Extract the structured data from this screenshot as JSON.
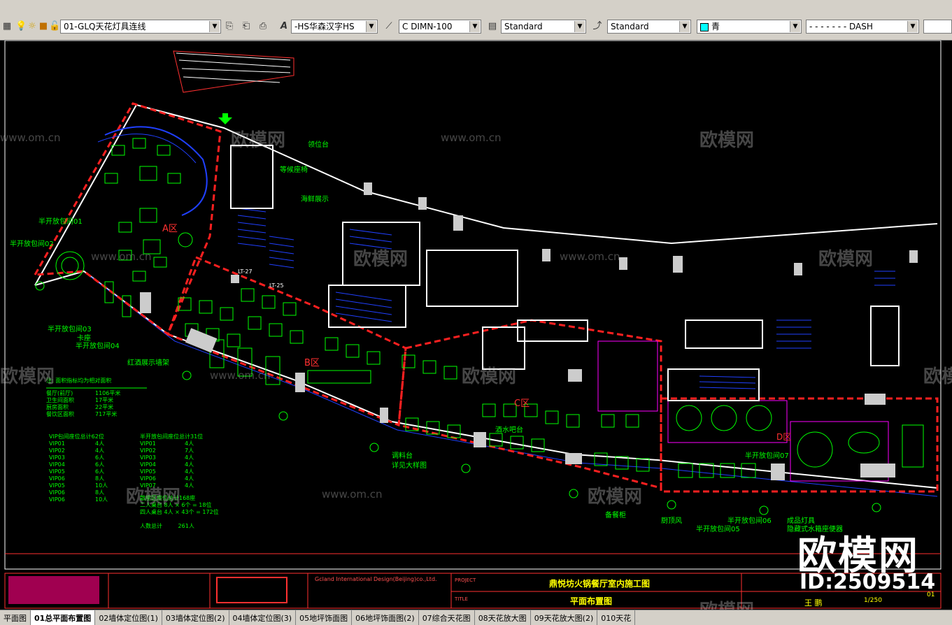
{
  "toolbar": {
    "layer_value": "01-GLQ天花灯具连线",
    "textstyle_value": "-HS华森汉字HS",
    "dimstyle_value": "C  DIMN-100",
    "tablestyle_value": "Standard",
    "mleaderstyle_value": "Standard",
    "color_value": "青",
    "linetype_value": "- - - - - - -  DASH"
  },
  "plan_labels": {
    "reception": "领位台",
    "waiting": "等候座椅",
    "seafood": "海鲜展示",
    "zone_a": "A区",
    "zone_b": "B区",
    "zone_c": "C区",
    "zone_d": "D区",
    "semi_private_01": "半开放包间01",
    "semi_private_02": "半开放包间02",
    "semi_private_03": "半开放包间03",
    "semi_private_04": "半开放包间04",
    "seating": "卡座",
    "wine_display": "红酒展示墙架",
    "sauce_station": "调料台",
    "sauce_detail": "详见大样图",
    "beverage": "酒水吧台",
    "prep_cabinet": "备餐柜",
    "kitchen_ventilation": "厨顶风",
    "semi_private_05": "半开放包间05",
    "semi_private_06": "半开放包间06",
    "semi_private_07": "半开放包间07",
    "lamp": "成品灯具",
    "concealed": "隐藏式水箱座便器",
    "lt27": "LT-27",
    "lt25": "LT-25"
  },
  "stats": {
    "title": "注: 面积指标均为相对面积",
    "rows": [
      {
        "k": "餐厅(前厅)",
        "v": "1106平米"
      },
      {
        "k": "卫生间面积",
        "v": "17平米"
      },
      {
        "k": "厨房面积",
        "v": "22平米"
      },
      {
        "k": "餐饮区面积",
        "v": "717平米"
      }
    ],
    "vip_header": "VIP包间座位总计62位",
    "semi_header": "半开放包间座位总计31位",
    "vip": [
      {
        "k": "VIP01",
        "v": "4人"
      },
      {
        "k": "VIP02",
        "v": "4人"
      },
      {
        "k": "VIP03",
        "v": "6人"
      },
      {
        "k": "VIP04",
        "v": "6人"
      },
      {
        "k": "VIP05",
        "v": "6人"
      },
      {
        "k": "VIP06",
        "v": "8人"
      },
      {
        "k": "VIP05",
        "v": "10人"
      },
      {
        "k": "VIP06",
        "v": "8人"
      },
      {
        "k": "VIP06",
        "v": "10人"
      }
    ],
    "semi": [
      {
        "k": "VIP01",
        "v": "4人"
      },
      {
        "k": "VIP02",
        "v": "7人"
      },
      {
        "k": "VIP03",
        "v": "4人"
      },
      {
        "k": "VIP04",
        "v": "4人"
      },
      {
        "k": "VIP05",
        "v": "4人"
      },
      {
        "k": "VIP06",
        "v": "4人"
      },
      {
        "k": "VIP07",
        "v": "4人"
      }
    ],
    "hall_header": "散座区座位总计168座",
    "two_person": "二人桌台",
    "two_val": "8人 × 6个 = 18位",
    "four_person": "四人桌台",
    "four_val": "4人 × 43个 = 172位",
    "total_label": "人数总计",
    "total_val": "261人"
  },
  "title_block": {
    "company": "Gcland International Design(Beijing)co.,Ltd.",
    "project_label": "PROJECT",
    "project_name": "鼎悦坊火锅餐厅室内施工图",
    "title_label": "TITLE",
    "drawing_name": "平面布置图",
    "designer": "王 鹏",
    "scale": "1/250",
    "sheet": "01"
  },
  "watermark": {
    "brand": "欧模网",
    "url": "www.om.cn",
    "id": "ID:2509514"
  },
  "tabs": [
    "平面图",
    "01总平面布置图",
    "02墙体定位图(1)",
    "03墙体定位图(2)",
    "04墙体定位图(3)",
    "05地坪饰面图",
    "06地坪饰面图(2)",
    "07综合天花图",
    "08天花放大图",
    "09天花放大图(2)",
    "010天花"
  ],
  "colors": {
    "wall": "#ffffff",
    "furniture": "#00ff00",
    "zone": "#ff2020",
    "stairs": "#2040ff",
    "text": "#00ff00",
    "magenta": "#ff00ff"
  }
}
